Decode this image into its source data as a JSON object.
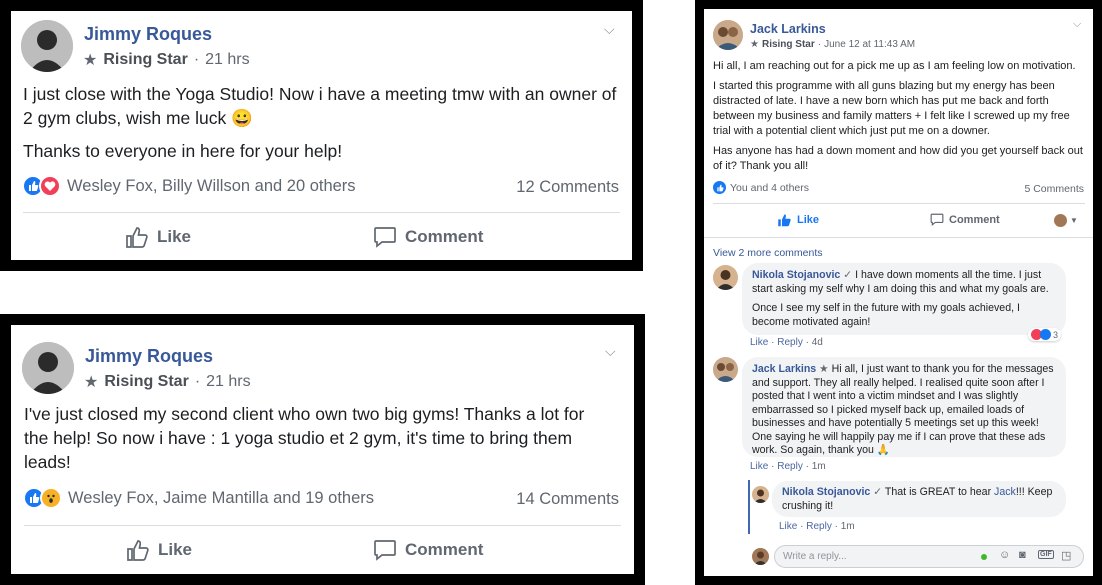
{
  "post1": {
    "author": "Jimmy Roques",
    "badge": "Rising Star",
    "time": "21 hrs",
    "paragraphs": [
      "I just close with the Yoga Studio! Now i have a meeting tmw with an owner of 2 gym clubs, wish me luck 😀",
      "Thanks to everyone in here for your help!"
    ],
    "reactors": "Wesley Fox, Billy Willson and 20 others",
    "comments": "12 Comments",
    "like_label": "Like",
    "comment_label": "Comment"
  },
  "post2": {
    "author": "Jimmy Roques",
    "badge": "Rising Star",
    "time": "21 hrs",
    "paragraphs": [
      "I've just closed my second client who own two big gyms! Thanks a lot for the help! So now i have : 1 yoga studio et 2 gym, it's time to bring them leads!"
    ],
    "reactors": "Wesley Fox, Jaime Mantilla and 19 others",
    "comments": "14 Comments",
    "like_label": "Like",
    "comment_label": "Comment"
  },
  "post3": {
    "author": "Jack Larkins",
    "badge": "Rising Star",
    "time": "June 12 at 11:43 AM",
    "paragraphs": [
      "Hi all, I am reaching out for a pick me up as I am feeling low on motivation.",
      "I started this programme with all guns blazing but my energy has been distracted of late. I have a new born which has put me back and forth between my business and family matters + I felt like I screwed up my free trial with a potential client which just put me on a downer.",
      "Has anyone has had a down moment and how did you get yourself back out of it? Thank you all!"
    ],
    "reactors": "You and 4 others",
    "comments": "5 Comments",
    "like_label": "Like",
    "comment_label": "Comment",
    "view_more": "View 2 more comments",
    "comment1": {
      "author": "Nikola Stojanovic",
      "text1": "I have down moments all the time. I just start asking my self why I am doing this and what my goals are.",
      "text2": "Once I see my self in the future with my goals achieved, I become motivated again!",
      "react_count": "3",
      "like": "Like",
      "reply": "Reply",
      "age": "4d"
    },
    "comment2": {
      "author": "Jack Larkins",
      "text": "Hi all, I just want to thank you for the messages and support. They all really helped. I realised quite soon after I posted that I went into a victim mindset and I was slightly embarrassed so I picked myself back up, emailed loads of businesses and have potentially 5 meetings set up this week! One saying he will happily pay me if I can prove that these ads work. So again, thank you 🙏",
      "like": "Like",
      "reply": "Reply",
      "age": "1m"
    },
    "reply1": {
      "author": "Nikola Stojanovic",
      "text_before": "That is GREAT to hear ",
      "mention": "Jack",
      "text_after": "!!! Keep crushing it!",
      "like": "Like",
      "reply": "Reply",
      "age": "1m"
    },
    "reply_placeholder": "Write a reply..."
  },
  "colors": {
    "link": "#385898",
    "like_blue": "#1877f2",
    "love_red": "#f33e58",
    "wow_yellow": "#f7b125"
  }
}
